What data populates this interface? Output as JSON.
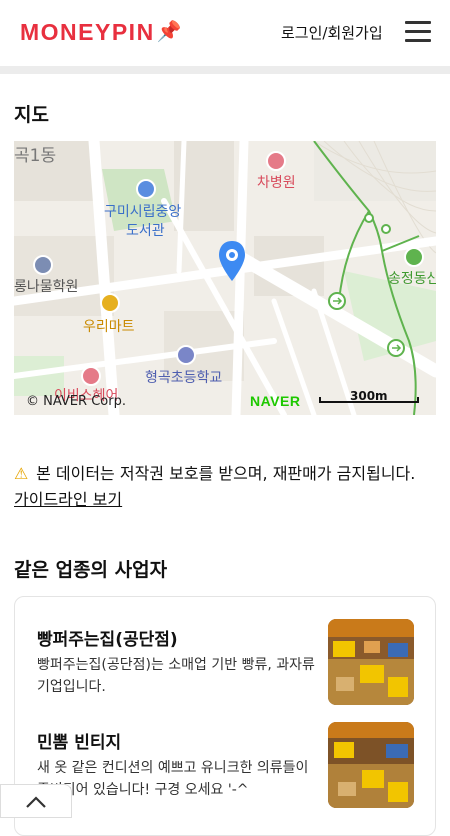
{
  "header": {
    "logo_text": "MONEYPIN",
    "logo_icon": "pin-icon",
    "login_label": "로그인/회원가입",
    "menu_icon": "hamburger-menu-icon",
    "brand_color": "#e8303f"
  },
  "map_section": {
    "title": "지도",
    "labels": {
      "gok1dong": "곡1동",
      "library": "구미시립중앙",
      "library2": "도서관",
      "hospital": "차병원",
      "academy": "롱나물학원",
      "mart": "우리마트",
      "school": "형곡초등학교",
      "songjeong": "송정동산",
      "beauty": "이비스헤어"
    },
    "copyright": "© NAVER Corp.",
    "naver_logo": "NAVER",
    "scale": "300m"
  },
  "notice": {
    "icon": "warning-icon",
    "text": "본 데이터는 저작권 보호를 받으며, 재판매가 금지됩니다.",
    "link": "가이드라인 보기"
  },
  "similar": {
    "title": "같은 업종의 사업자",
    "items": [
      {
        "name": "빵퍼주는집(공단점)",
        "desc": "빵퍼주는집(공단점)는 소매업 기반 빵류, 과자류 기업입니다."
      },
      {
        "name": "민뽐 빈티지",
        "desc": "새 옷 같은 컨디션의 예쁘고 유니크한 의류들이 준비되어 있습니다! 구경 오세요 '-^"
      }
    ]
  },
  "scroll_top_icon": "chevron-up-icon"
}
